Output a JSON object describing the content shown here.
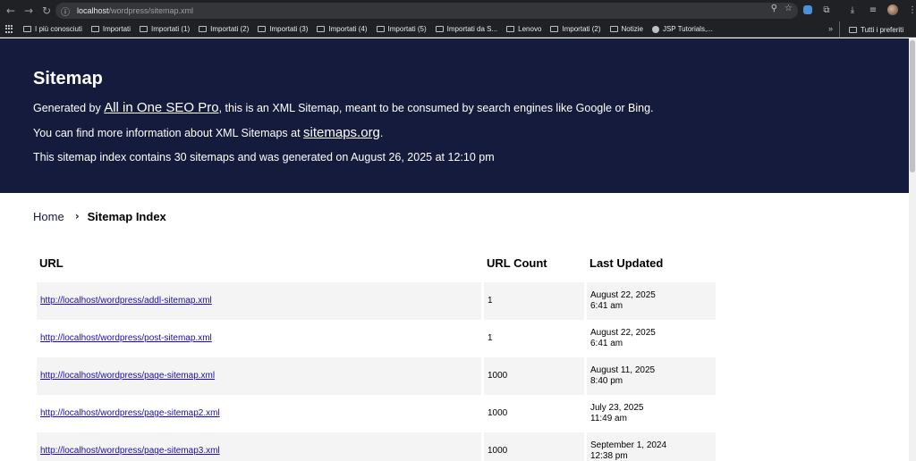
{
  "browser": {
    "url_host": "localhost",
    "url_path": "/wordpress/sitemap.xml",
    "bookmarks": [
      {
        "label": "I più conosciuti",
        "icon": "folder-icon"
      },
      {
        "label": "Importati",
        "icon": "folder-icon"
      },
      {
        "label": "Importati (1)",
        "icon": "folder-icon"
      },
      {
        "label": "Importati (2)",
        "icon": "folder-icon"
      },
      {
        "label": "Importati (3)",
        "icon": "folder-icon"
      },
      {
        "label": "Importati (4)",
        "icon": "folder-icon"
      },
      {
        "label": "Importati (5)",
        "icon": "folder-icon"
      },
      {
        "label": "Importati da S...",
        "icon": "folder-icon"
      },
      {
        "label": "Lenovo",
        "icon": "folder-icon"
      },
      {
        "label": "Importati (2)",
        "icon": "folder-icon"
      },
      {
        "label": "Notizie",
        "icon": "folder-icon"
      },
      {
        "label": "JSP Tutorials,...",
        "icon": "globe-icon"
      }
    ],
    "more_label": "»",
    "all_bookmarks_label": "Tutti i preferiti"
  },
  "hero": {
    "title": "Sitemap",
    "line1_pre": "Generated by ",
    "line1_link": "All in One SEO Pro",
    "line1_post": ", this is an XML Sitemap, meant to be consumed by search engines like Google or Bing.",
    "line2_pre": "You can find more information about XML Sitemaps at ",
    "line2_link": "sitemaps.org",
    "line2_post": ".",
    "line3": "This sitemap index contains 30 sitemaps and was generated on August 26, 2025 at 12:10 pm"
  },
  "breadcrumb": {
    "home": "Home",
    "separator": "›",
    "current": "Sitemap Index"
  },
  "table": {
    "headers": [
      "URL",
      "URL Count",
      "Last Updated"
    ],
    "rows": [
      {
        "url": "http://localhost/wordpress/addl-sitemap.xml",
        "count": "1",
        "date": "August 22, 2025",
        "time": "6:41 am"
      },
      {
        "url": "http://localhost/wordpress/post-sitemap.xml",
        "count": "1",
        "date": "August 22, 2025",
        "time": "6:41 am"
      },
      {
        "url": "http://localhost/wordpress/page-sitemap.xml",
        "count": "1000",
        "date": "August 11, 2025",
        "time": "8:40 pm"
      },
      {
        "url": "http://localhost/wordpress/page-sitemap2.xml",
        "count": "1000",
        "date": "July 23, 2025",
        "time": "11:49 am"
      },
      {
        "url": "http://localhost/wordpress/page-sitemap3.xml",
        "count": "1000",
        "date": "September 1, 2024",
        "time": "12:38 pm"
      }
    ]
  },
  "colors": {
    "hero_bg": "#141b3c",
    "link": "#1a0dab",
    "row_alt": "#f4f4f4"
  }
}
